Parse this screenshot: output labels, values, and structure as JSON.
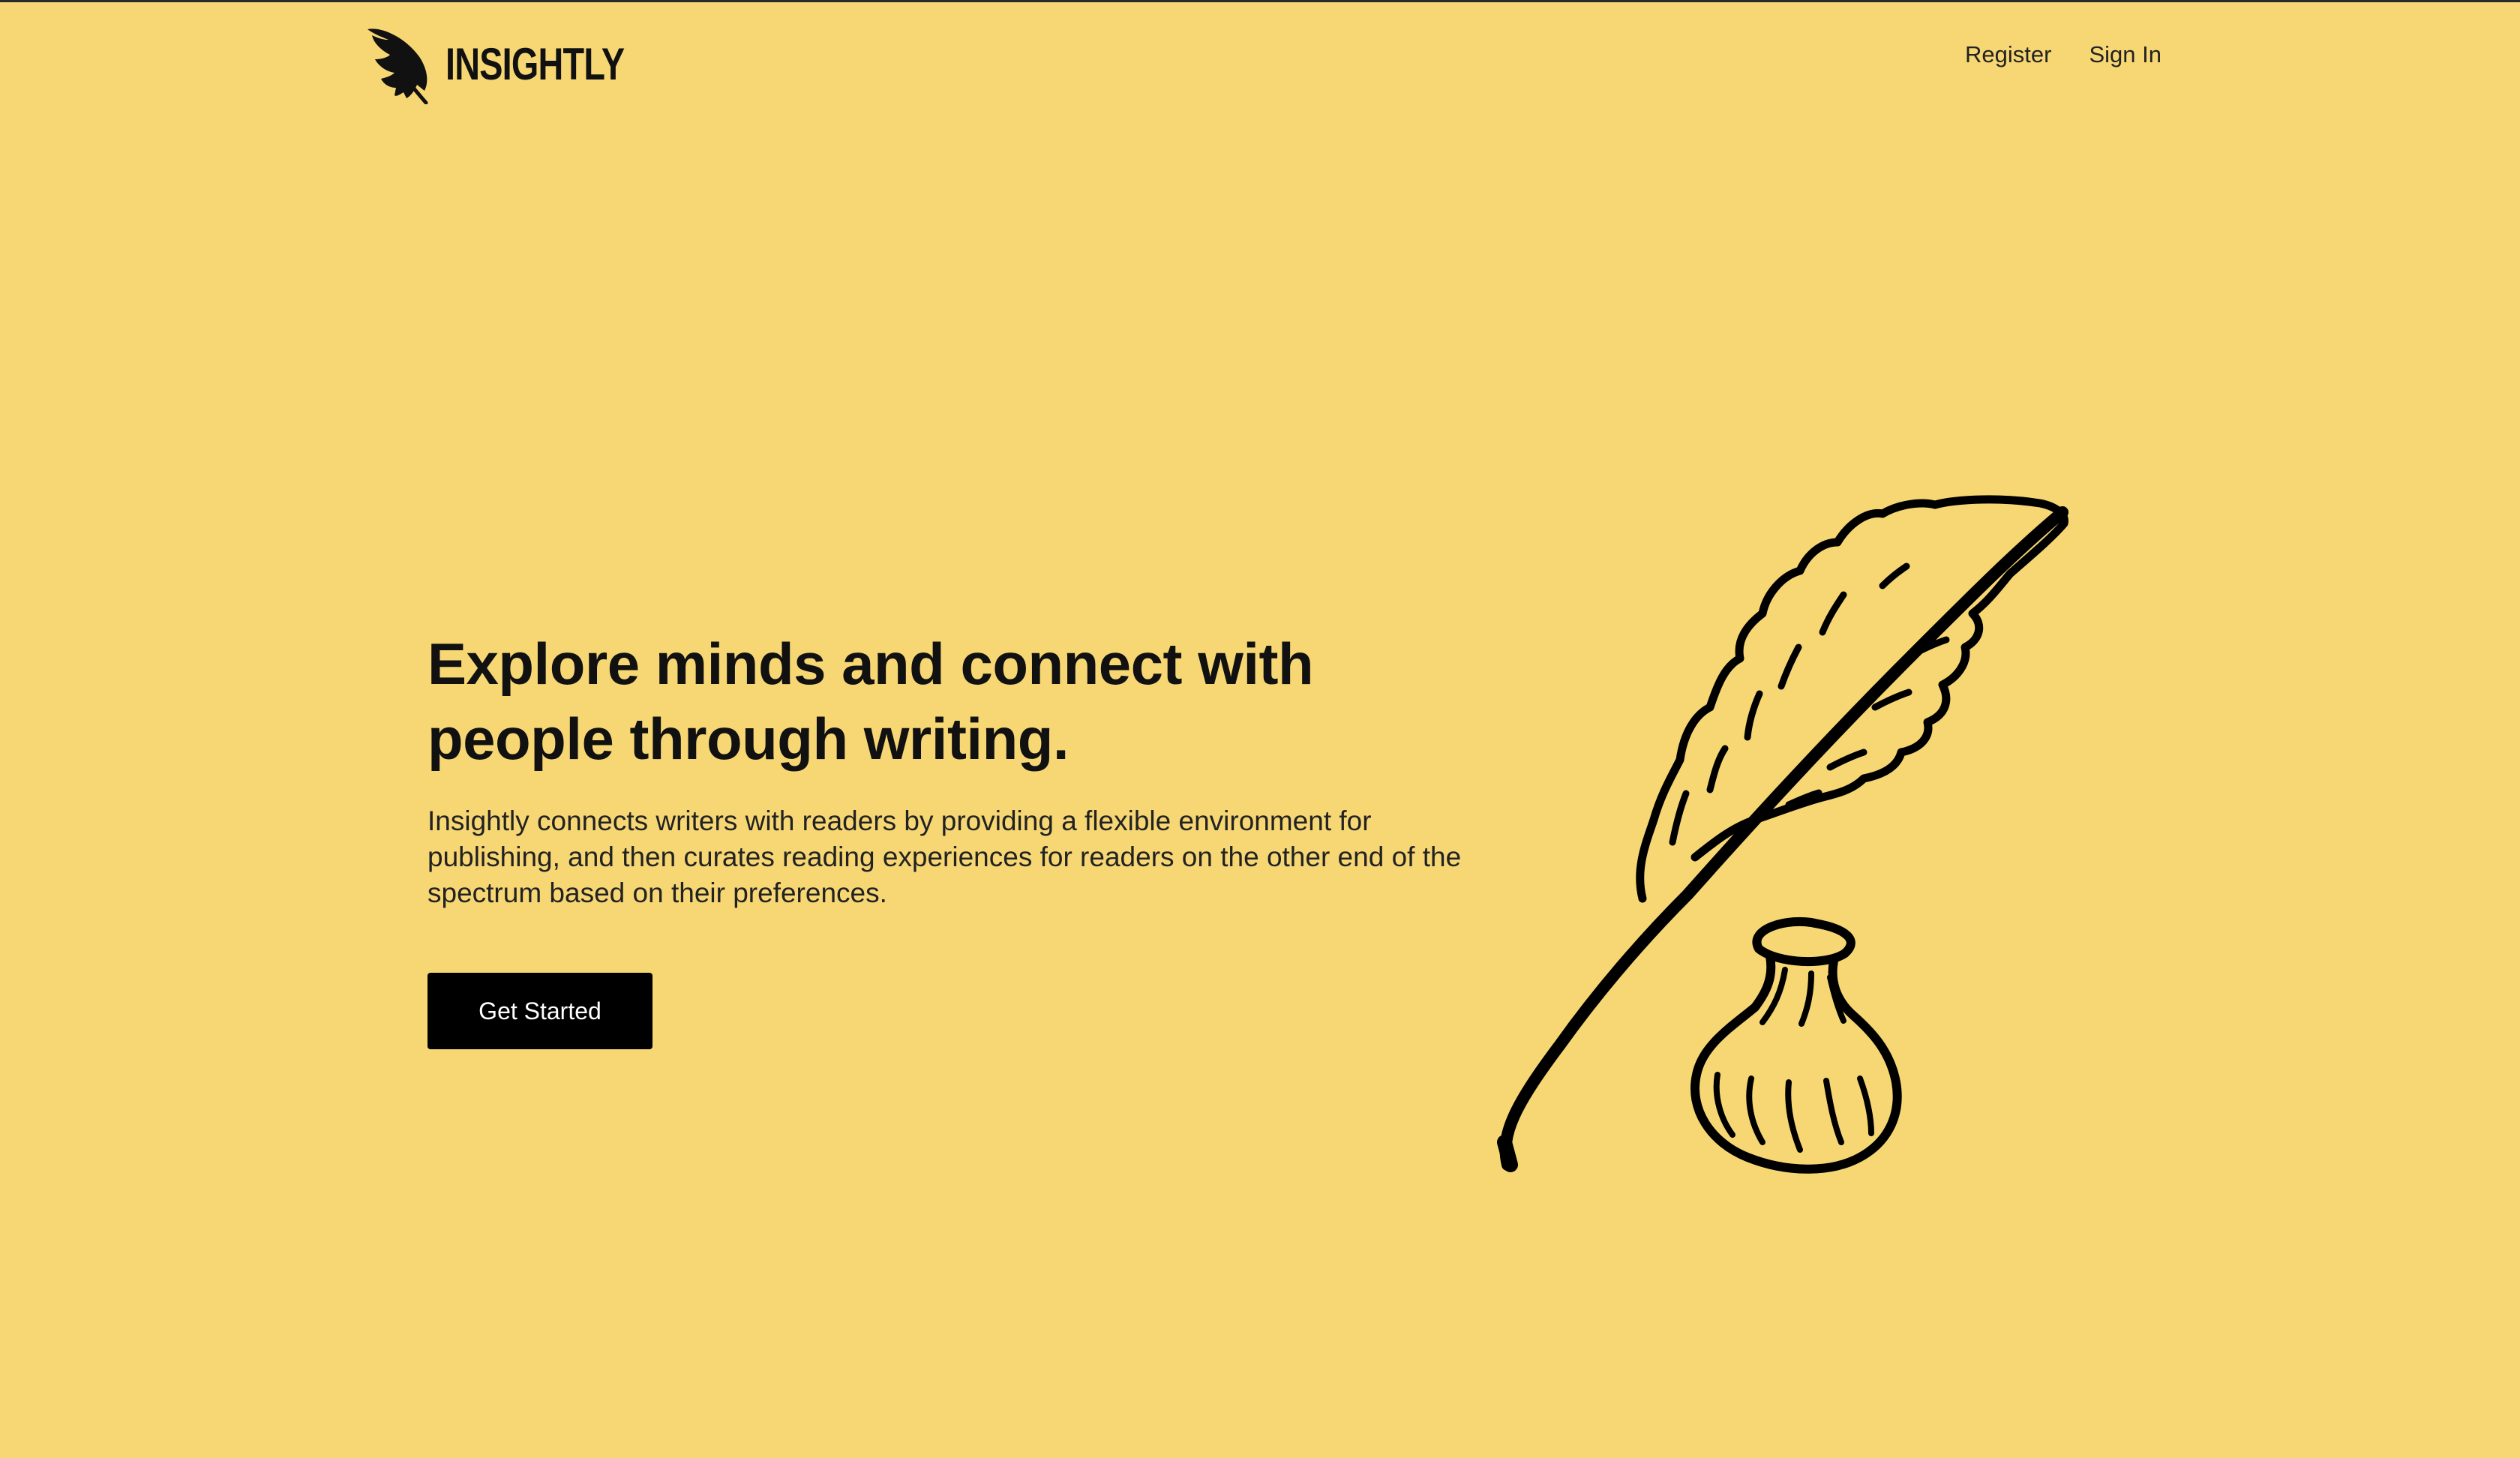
{
  "theme": {
    "background": "#F7D774",
    "text": "#111111",
    "nav_text": "#222222",
    "button_bg": "#000000",
    "button_text": "#FFFFFF"
  },
  "header": {
    "brand": {
      "name": "INSIGHTLY",
      "icon": "quill-feather-icon"
    },
    "nav": [
      {
        "label": "Register"
      },
      {
        "label": "Sign In"
      }
    ]
  },
  "hero": {
    "title": "Explore minds and connect with people through writing.",
    "description": "Insightly connects writers with readers by providing a flexible environment for publishing, and then curates reading experiences for readers on the other end of the spectrum based on their preferences.",
    "cta_label": "Get Started",
    "illustration": "quill-and-inkwell-illustration"
  }
}
